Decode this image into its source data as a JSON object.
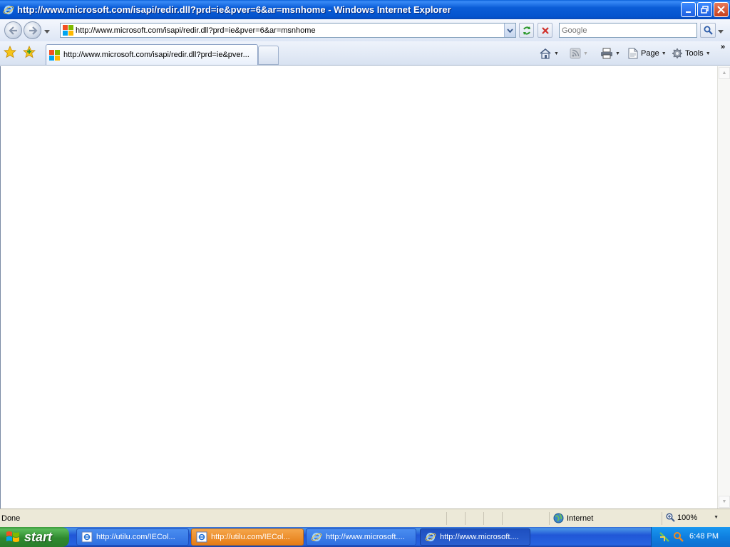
{
  "window": {
    "title": "http://www.microsoft.com/isapi/redir.dll?prd=ie&pver=6&ar=msnhome - Windows Internet Explorer"
  },
  "navbar": {
    "address_value": "http://www.microsoft.com/isapi/redir.dll?prd=ie&pver=6&ar=msnhome",
    "search_placeholder": "Google"
  },
  "tabs": {
    "active_tab_label": "http://www.microsoft.com/isapi/redir.dll?prd=ie&pver..."
  },
  "commandbar": {
    "page_label": "Page",
    "tools_label": "Tools"
  },
  "statusbar": {
    "status": "Done",
    "zone": "Internet",
    "zoom": "100%"
  },
  "taskbar": {
    "start_label": "start",
    "tasks": [
      {
        "label": "http://utilu.com/IECol..."
      },
      {
        "label": "http://utilu.com/IECol..."
      },
      {
        "label": "http://www.microsoft...."
      },
      {
        "label": "http://www.microsoft...."
      }
    ],
    "clock": "6:48 PM"
  },
  "colors": {
    "titlebar_blue": "#0453cd",
    "taskbar_blue": "#2157d7",
    "start_green": "#2f8a2f",
    "status_bg": "#ece9d8"
  }
}
